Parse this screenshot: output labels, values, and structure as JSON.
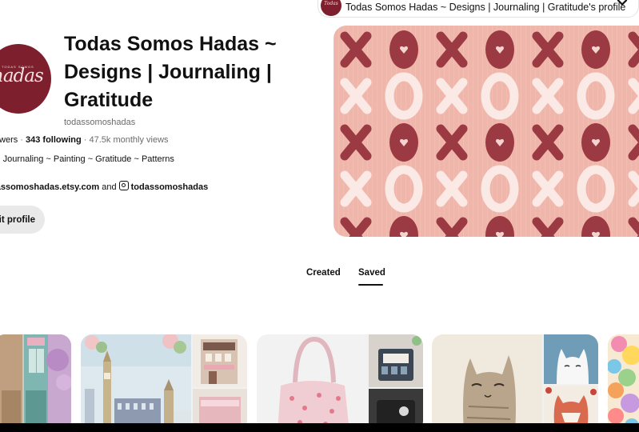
{
  "profile_switcher": {
    "label": "Todas Somos Hadas ~ Designs | Journaling | Gratitude's profile",
    "avatar_text": "Todas"
  },
  "profile": {
    "avatar_text": "hadas",
    "avatar_tiny": "TODAS SOMOS",
    "name": "Todas Somos Hadas ~ Designs | Journaling | Gratitude",
    "handle": "todassomoshadas",
    "followers_text": "llowers",
    "separator": " · ",
    "following_text": "343 following",
    "monthly_views": "47.5k monthly views",
    "bio": "t ~ Journaling ~ Painting ~ Gratitude ~ Patterns",
    "website": "dassomoshadas.etsy.com",
    "and_text": "and",
    "instagram": "todassomoshadas",
    "edit_button": "it profile"
  },
  "tabs": {
    "created": "Created",
    "saved": "Saved",
    "active": "saved"
  },
  "colors": {
    "accent_burgundy": "#7d1f2c",
    "cover_pink": "#efb7ab",
    "xo_dark": "#9c3a44",
    "xo_light": "#fbe9e5"
  },
  "icons": {
    "chevron": "chevron-down-icon",
    "instagram": "instagram-icon"
  }
}
